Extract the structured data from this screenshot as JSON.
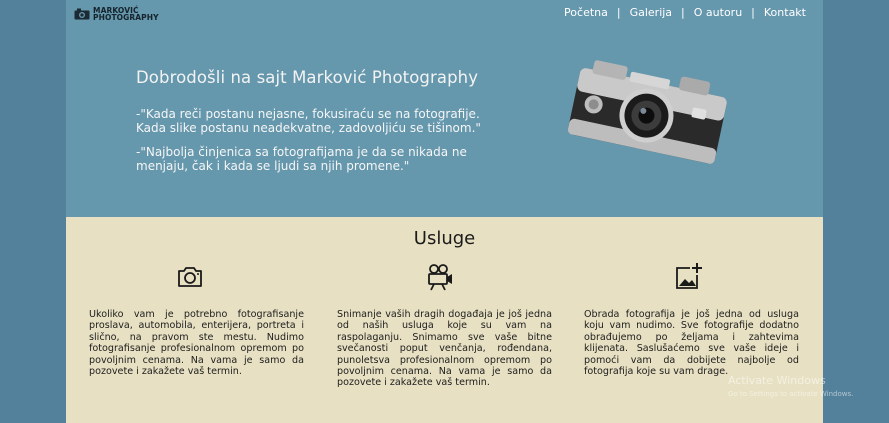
{
  "logo": {
    "line1": "MARKOVIĆ",
    "line2": "PHOTOGRAPHY"
  },
  "nav": {
    "items": [
      "Početna",
      "Galerija",
      "O autoru",
      "Kontakt"
    ],
    "separator": "|"
  },
  "hero": {
    "title": "Dobrodošli na sajt Marković Photography",
    "quote1": "-\"Kada reči postanu nejasne, fokusiraću se na fotografije. Kada slike postanu neadekvatne, zadovoljiću se tišinom.\"",
    "quote2": "-\"Najbolja činjenica sa fotografijama je da se nikada ne menjaju, čak i kada se ljudi sa njih promene.\""
  },
  "services": {
    "title": "Usluge",
    "items": [
      {
        "icon": "camera-icon",
        "text": "Ukoliko vam je potrebno fotografisanje proslava, automobila, enterijera, portreta i slično, na pravom ste mestu. Nudimo fotografisanje profesionalnom opremom po povoljnim cenama. Na vama je samo da pozovete i zakažete vaš termin."
      },
      {
        "icon": "movie-camera-icon",
        "text": "Snimanje vaših dragih događaja je još jedna od naših usluga koje su vam na raspolaganju. Snimamo sve vaše bitne svečanosti poput venčanja, rođendana, punoletsva profesionalnom opremom po povoljnim cenama. Na vama je samo da pozovete i zakažete vaš termin."
      },
      {
        "icon": "add-photo-icon",
        "text": "Obrada fotografija je još jedna od usluga koju vam nudimo. Sve fotografije dodatno obrađujemo po željama i zahtevima klijenata. Saslušaćemo sve vaše ideje i pomoći vam da dobijete najbolje od fotografija koje su vam drage."
      }
    ]
  },
  "watermark": {
    "title": "Activate Windows",
    "subtitle": "Go to Settings to activate Windows."
  },
  "colors": {
    "background": "#53809a",
    "hero": "#6597ad",
    "services": "#e7e0c2"
  }
}
